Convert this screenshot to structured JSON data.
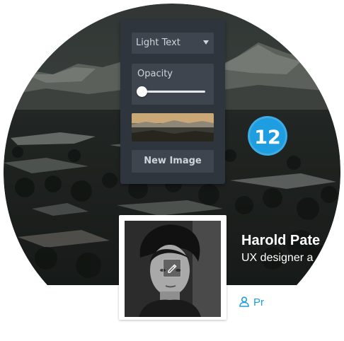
{
  "step_badge": "12",
  "panel": {
    "text_style": "Light Text",
    "opacity_label": "Opacity",
    "opacity_value": 0.05,
    "new_image_label": "New Image"
  },
  "profile": {
    "name": "Harold Pate",
    "subtitle": "UX designer a",
    "link_label": "Pr"
  },
  "colors": {
    "accent": "#1e9de0",
    "panel": "#2f353d",
    "panel_control": "#3e454e"
  }
}
